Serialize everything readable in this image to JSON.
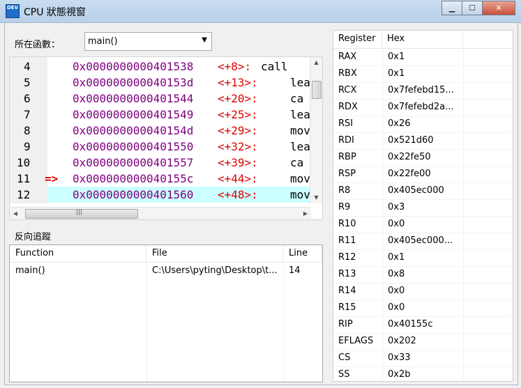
{
  "window": {
    "icon_text": "DEV",
    "title": "CPU 狀態視窗",
    "buttons": {
      "minimize": "▁",
      "maximize": "☐",
      "close": "✕"
    }
  },
  "function_selector": {
    "label": "所在函數：",
    "value": "main()"
  },
  "disassembly": [
    {
      "line": "4",
      "marker": "",
      "addr": "0x0000000000401538",
      "offset": "<+8>:",
      "ins": "call",
      "highlight": false
    },
    {
      "line": "5",
      "marker": "",
      "addr": "0x000000000040153d",
      "offset": "<+13>:",
      "ins": "lea",
      "highlight": false
    },
    {
      "line": "6",
      "marker": "",
      "addr": "0x0000000000401544",
      "offset": "<+20>:",
      "ins": "ca",
      "highlight": false
    },
    {
      "line": "7",
      "marker": "",
      "addr": "0x0000000000401549",
      "offset": "<+25>:",
      "ins": "lea",
      "highlight": false
    },
    {
      "line": "8",
      "marker": "",
      "addr": "0x000000000040154d",
      "offset": "<+29>:",
      "ins": "mov",
      "highlight": false
    },
    {
      "line": "9",
      "marker": "",
      "addr": "0x0000000000401550",
      "offset": "<+32>:",
      "ins": "lea",
      "highlight": false
    },
    {
      "line": "10",
      "marker": "",
      "addr": "0x0000000000401557",
      "offset": "<+39>:",
      "ins": "ca",
      "highlight": false
    },
    {
      "line": "11",
      "marker": "=>",
      "addr": "0x000000000040155c",
      "offset": "<+44>:",
      "ins": "mov",
      "highlight": false
    },
    {
      "line": "12",
      "marker": "",
      "addr": "0x0000000000401560",
      "offset": "<+48>:",
      "ins": "mov",
      "highlight": true
    }
  ],
  "backtrace": {
    "label": "反向追蹤",
    "columns": [
      "Function",
      "File",
      "Line"
    ],
    "rows": [
      {
        "function": "main()",
        "file": "C:\\Users\\pyting\\Desktop\\t...",
        "line": "14"
      }
    ]
  },
  "registers": {
    "columns": [
      "Register",
      "Hex"
    ],
    "rows": [
      {
        "name": "RAX",
        "hex": "0x1"
      },
      {
        "name": "RBX",
        "hex": "0x1"
      },
      {
        "name": "RCX",
        "hex": "0x7fefebd15..."
      },
      {
        "name": "RDX",
        "hex": "0x7fefebd2a..."
      },
      {
        "name": "RSI",
        "hex": "0x26"
      },
      {
        "name": "RDI",
        "hex": "0x521d60"
      },
      {
        "name": "RBP",
        "hex": "0x22fe50"
      },
      {
        "name": "RSP",
        "hex": "0x22fe00"
      },
      {
        "name": "R8",
        "hex": "0x405ec000"
      },
      {
        "name": "R9",
        "hex": "0x3"
      },
      {
        "name": "R10",
        "hex": "0x0"
      },
      {
        "name": "R11",
        "hex": "0x405ec000..."
      },
      {
        "name": "R12",
        "hex": "0x1"
      },
      {
        "name": "R13",
        "hex": "0x8"
      },
      {
        "name": "R14",
        "hex": "0x0"
      },
      {
        "name": "R15",
        "hex": "0x0"
      },
      {
        "name": "RIP",
        "hex": "0x40155c"
      },
      {
        "name": "EFLAGS",
        "hex": "0x202"
      },
      {
        "name": "CS",
        "hex": "0x33"
      },
      {
        "name": "SS",
        "hex": "0x2b"
      }
    ]
  },
  "colors": {
    "address": "#800080",
    "offset": "#e00000",
    "highlight_row": "#ccffff"
  }
}
